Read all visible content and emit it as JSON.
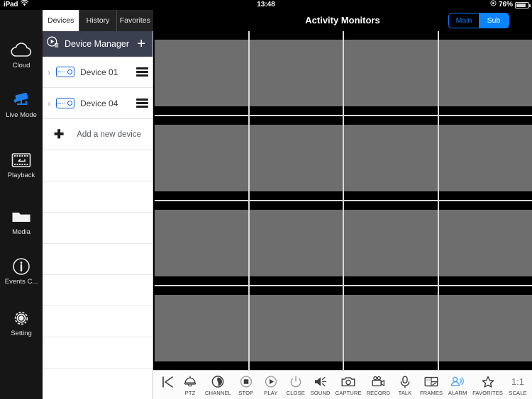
{
  "status_bar": {
    "device": "iPad",
    "wifi_icon": "wifi-icon",
    "time": "13:48",
    "location_icon": "location-services-icon",
    "battery_percent": "76%",
    "battery_icon": "battery-icon"
  },
  "tabs": [
    {
      "label": "Devices",
      "active": true
    },
    {
      "label": "History",
      "active": false
    },
    {
      "label": "Favorites",
      "active": false
    }
  ],
  "header": {
    "title": "Activity Monitors",
    "stream_toggle": {
      "options": [
        "Main",
        "Sub"
      ],
      "selected": "Sub"
    }
  },
  "sidebar": {
    "items": [
      {
        "label": "Cloud",
        "icon": "cloud-icon",
        "active": false
      },
      {
        "label": "Live Mode",
        "icon": "cctv-camera-icon",
        "active": true
      },
      {
        "label": "Playback",
        "icon": "film-replay-icon",
        "active": false
      },
      {
        "label": "Media",
        "icon": "folder-icon",
        "active": false
      },
      {
        "label": "Events C...",
        "icon": "info-circle-icon",
        "active": false
      },
      {
        "label": "Setting",
        "icon": "gear-icon",
        "active": false
      }
    ]
  },
  "device_panel": {
    "header": {
      "title": "Device Manager",
      "icon": "device-manager-icon",
      "add_label": "+"
    },
    "devices": [
      {
        "name": "Device 01",
        "icon": "dvr-device-icon",
        "expand_icon": "chevron-right-icon",
        "menu_icon": "hamburger-menu-icon"
      },
      {
        "name": "Device 04",
        "icon": "dvr-device-icon",
        "expand_icon": "chevron-right-icon",
        "menu_icon": "hamburger-menu-icon"
      }
    ],
    "add_device": {
      "label": "Add a new device",
      "icon": "plus-icon"
    },
    "empty_rows": 8
  },
  "video_grid": {
    "rows": 4,
    "columns": 4,
    "panes": [
      {
        "id": 1
      },
      {
        "id": 2
      },
      {
        "id": 3
      },
      {
        "id": 4
      },
      {
        "id": 5
      },
      {
        "id": 6
      },
      {
        "id": 7
      },
      {
        "id": 8
      },
      {
        "id": 9
      },
      {
        "id": 10
      },
      {
        "id": 11
      },
      {
        "id": 12
      },
      {
        "id": 13
      },
      {
        "id": 14
      },
      {
        "id": 15
      },
      {
        "id": 16
      }
    ]
  },
  "bottom_toolbar": {
    "back_icon": "skip-to-start-icon",
    "items": [
      {
        "label": "PTZ",
        "icon": "ptz-dome-icon",
        "accent": false
      },
      {
        "label": "CHANNEL",
        "icon": "channel-dial-icon",
        "accent": false
      },
      {
        "label": "STOP",
        "icon": "stop-icon",
        "accent": false
      },
      {
        "label": "PLAY",
        "icon": "play-icon",
        "accent": false
      },
      {
        "label": "CLOSE",
        "icon": "power-icon",
        "accent": false
      },
      {
        "label": "SOUND",
        "icon": "speaker-icon",
        "accent": false
      },
      {
        "label": "CAPTURE",
        "icon": "camera-icon",
        "accent": false
      },
      {
        "label": "RECORD",
        "icon": "video-camera-icon",
        "accent": false
      },
      {
        "label": "TALK",
        "icon": "microphone-icon",
        "accent": false
      },
      {
        "label": "FRAMES",
        "icon": "frames-layout-icon",
        "accent": false
      },
      {
        "label": "ALARM",
        "icon": "alarm-person-icon",
        "accent": true
      },
      {
        "label": "FAVORITES",
        "icon": "star-icon",
        "accent": false
      },
      {
        "label": "SCALE",
        "icon": "scale-ratio-icon",
        "value": "1:1",
        "accent": false
      }
    ]
  },
  "colors": {
    "accent_blue": "#0a84ff",
    "panel_header": "#3a4050",
    "device_icon_blue": "#1060d8",
    "video_gray": "#6e6e6e"
  }
}
